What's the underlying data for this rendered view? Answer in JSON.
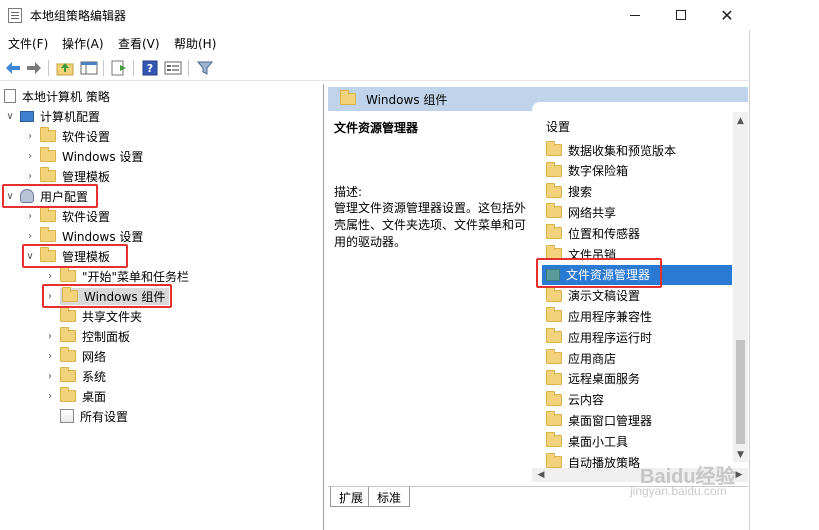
{
  "window": {
    "title": "本地组策略编辑器",
    "minimize": "—",
    "close": "✕"
  },
  "menu": [
    "文件(F)",
    "操作(A)",
    "查看(V)",
    "帮助(H)"
  ],
  "toolbar": [
    "back-arrow-icon",
    "forward-arrow-icon",
    "up-folder-icon",
    "show-hide-tree-icon",
    "export-list-icon",
    "help-icon",
    "properties-icon",
    "filter-icon"
  ],
  "tree": {
    "root": "本地计算机 策略",
    "computer_config": "计算机配置",
    "cc_software": "软件设置",
    "cc_windows": "Windows 设置",
    "cc_admin": "管理模板",
    "user_config": "用户配置",
    "uc_software": "软件设置",
    "uc_windows": "Windows 设置",
    "uc_admin": "管理模板",
    "start_menu": "\"开始\"菜单和任务栏",
    "windows_components": "Windows 组件",
    "shared_folders": "共享文件夹",
    "control_panel": "控制面板",
    "network": "网络",
    "system": "系统",
    "desktop": "桌面",
    "all_settings": "所有设置"
  },
  "right": {
    "header": "Windows 组件",
    "selected_title": "文件资源管理器",
    "desc_label": "描述:",
    "desc_text": "管理文件资源管理器设置。这包括外壳属性、文件夹选项、文件菜单和可用的驱动器。",
    "list_header": "设置",
    "items": [
      "数据收集和预览版本",
      "数字保险箱",
      "搜索",
      "网络共享",
      "位置和传感器",
      "文件吊销",
      "文件资源管理器",
      "演示文稿设置",
      "应用程序兼容性",
      "应用程序运行时",
      "应用商店",
      "远程桌面服务",
      "云内容",
      "桌面窗口管理器",
      "桌面小工具",
      "自动播放策略"
    ],
    "selected_index": 6,
    "tabs": [
      "扩展",
      "标准"
    ]
  },
  "watermark": {
    "main": "Baidu经验",
    "sub": "jingyan.baidu.com"
  }
}
